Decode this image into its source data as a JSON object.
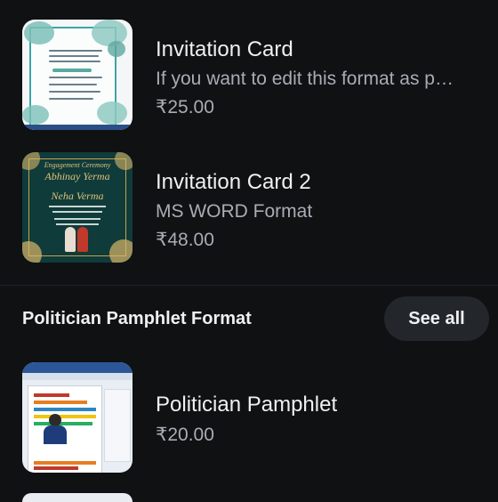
{
  "products": [
    {
      "title": "Invitation Card",
      "subtitle": "If you want to edit this format as p…",
      "price": "₹25.00"
    },
    {
      "title": "Invitation Card 2",
      "subtitle": "MS WORD Format",
      "price": "₹48.00"
    }
  ],
  "thumb2": {
    "line1": "Engagement Ceremony",
    "line2": "Abhinay Yerma",
    "line3": "Neha Verma"
  },
  "section": {
    "title": "Politician Pamphlet Format",
    "see_all": "See all"
  },
  "section_products": [
    {
      "title": "Politician Pamphlet",
      "price": "₹20.00"
    }
  ]
}
